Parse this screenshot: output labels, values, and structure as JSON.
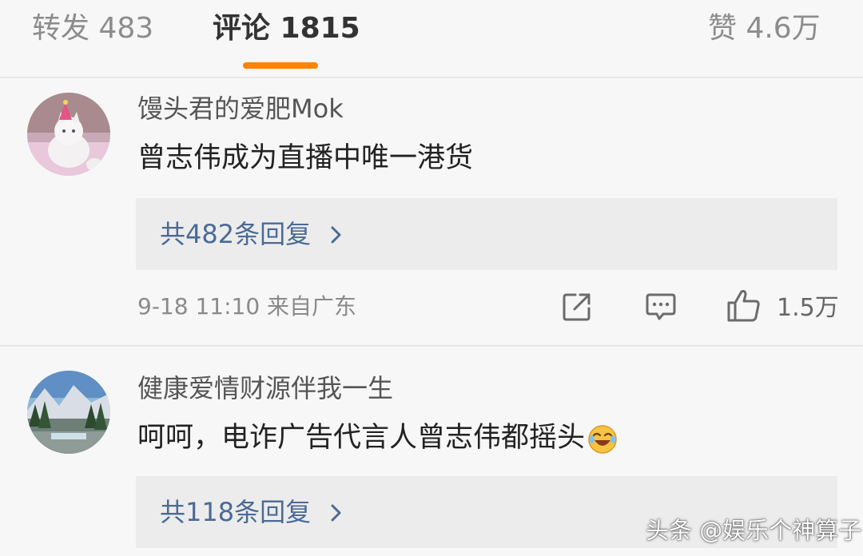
{
  "tabs": {
    "reposts": "转发 483",
    "comments": "评论 1815",
    "likes": "赞 4.6万"
  },
  "comments": [
    {
      "username": "馒头君的爱肥Mok",
      "text": "曾志伟成为直播中唯一港货",
      "replies": "共482条回复",
      "time_location": "9-18 11:10 来自广东",
      "like_count": "1.5万"
    },
    {
      "username": "健康爱情财源伴我一生",
      "text": "呵呵，电诈广告代言人曾志伟都摇头",
      "replies": "共118条回复"
    }
  ],
  "watermark": "头条 @娱乐个神算子",
  "icons": [
    "repost-icon",
    "comment-icon",
    "like-icon",
    "chevron-right-icon",
    "laughing-emoji-icon"
  ],
  "colors": {
    "accent": "#ff8200",
    "link": "#4a6a96",
    "background": "#f7f7f7"
  }
}
